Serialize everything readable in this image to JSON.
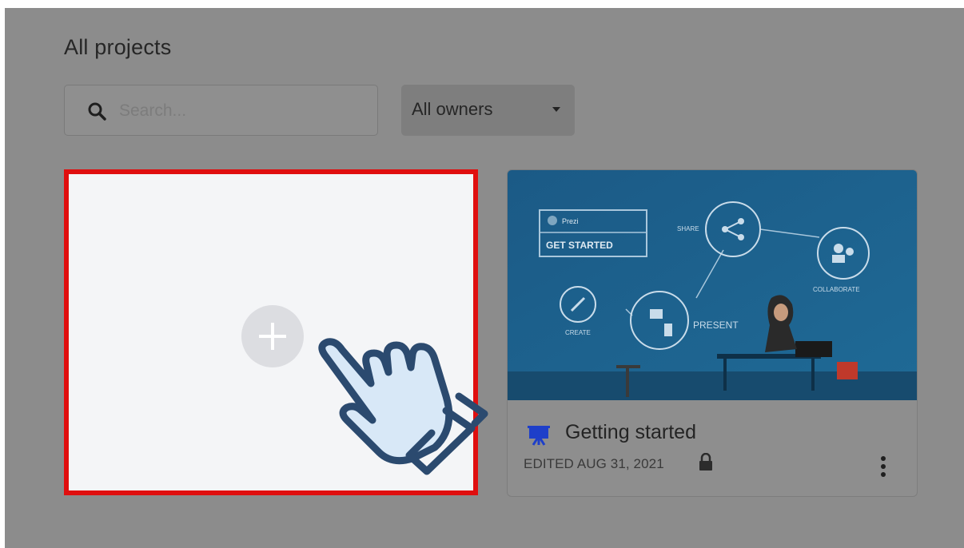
{
  "header": {
    "title": "All projects"
  },
  "search": {
    "placeholder": "Search..."
  },
  "owner_filter": {
    "selected": "All owners"
  },
  "new_project_card": {
    "icon": "plus-circle-icon"
  },
  "projects": [
    {
      "title": "Getting started",
      "edited": "EDITED AUG 31, 2021",
      "icon": "presentation-easel-icon",
      "locked": true,
      "thumbnail": {
        "get_started": "GET STARTED",
        "prezi": "Prezi",
        "share": "SHARE",
        "collaborate": "COLLABORATE",
        "present": "PRESENT",
        "create": "CREATE"
      }
    }
  ],
  "overlay": {
    "icon": "pointing-hand-click-icon"
  },
  "colors": {
    "dim_overlay": "#8c8c8c",
    "highlight": "#e00f0f",
    "thumbnail_blue": "#1f5f8b",
    "hand_outline": "#2b4a6f",
    "hand_fill": "#d8e8f7"
  }
}
